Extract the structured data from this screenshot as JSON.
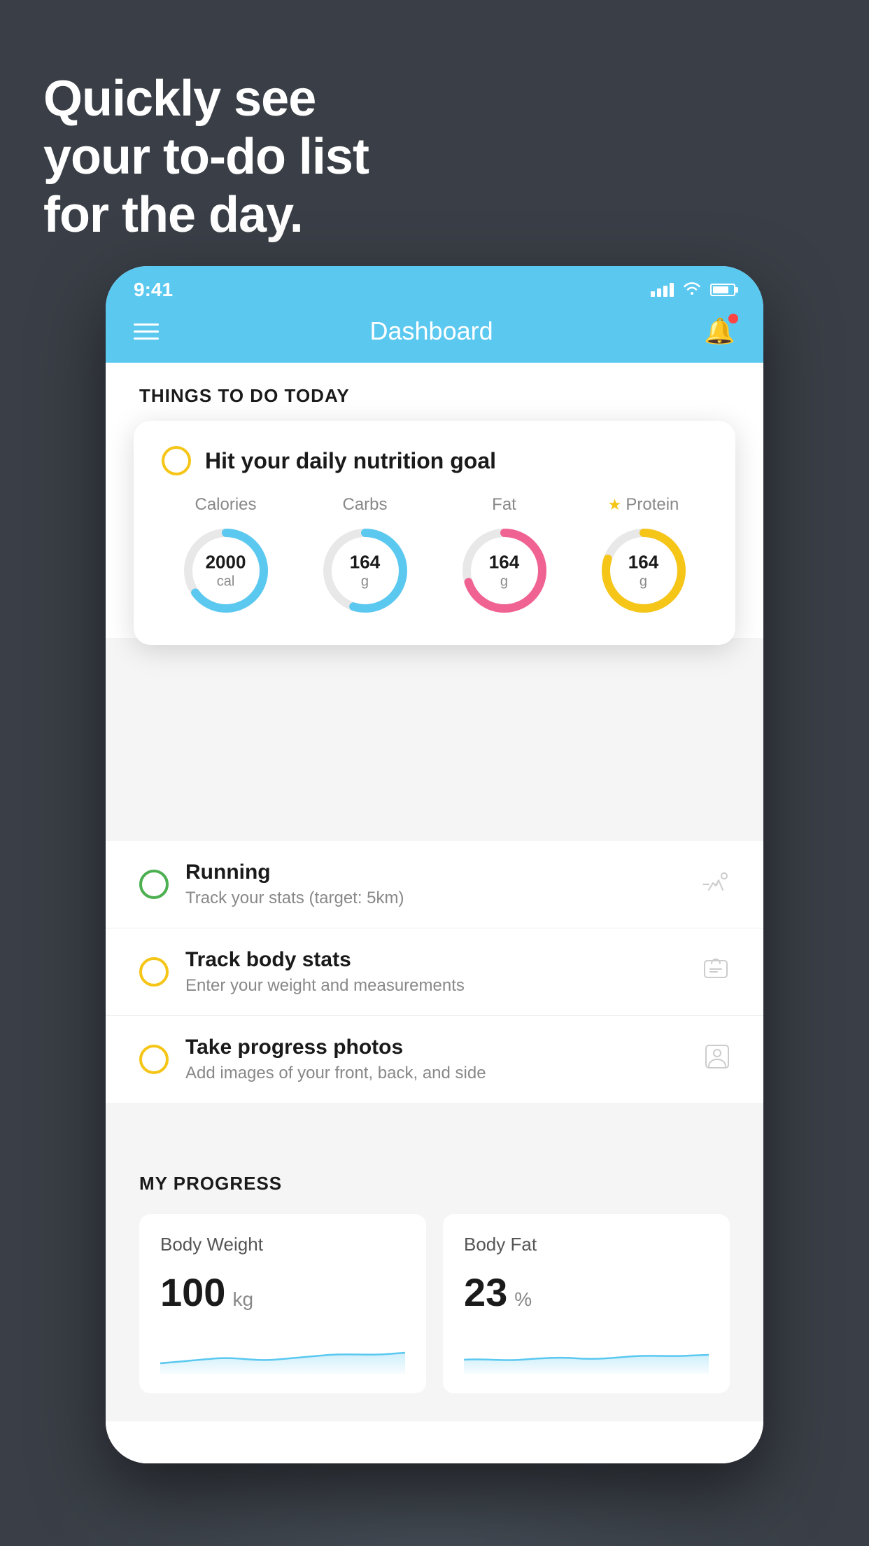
{
  "hero": {
    "line1": "Quickly see",
    "line2": "your to-do list",
    "line3": "for the day."
  },
  "status_bar": {
    "time": "9:41"
  },
  "nav": {
    "title": "Dashboard"
  },
  "things_today": {
    "section_label": "THINGS TO DO TODAY"
  },
  "nutrition_card": {
    "title": "Hit your daily nutrition goal",
    "metrics": [
      {
        "label": "Calories",
        "value": "2000",
        "unit": "cal",
        "color": "#5bc8f0",
        "percent": 65
      },
      {
        "label": "Carbs",
        "value": "164",
        "unit": "g",
        "color": "#5bc8f0",
        "percent": 55
      },
      {
        "label": "Fat",
        "value": "164",
        "unit": "g",
        "color": "#f06292",
        "percent": 70
      },
      {
        "label": "Protein",
        "value": "164",
        "unit": "g",
        "color": "#f5c518",
        "percent": 80,
        "has_star": true
      }
    ]
  },
  "todo_items": [
    {
      "title": "Running",
      "subtitle": "Track your stats (target: 5km)",
      "circle_color": "green",
      "icon": "🏃"
    },
    {
      "title": "Track body stats",
      "subtitle": "Enter your weight and measurements",
      "circle_color": "yellow",
      "icon": "⚖️"
    },
    {
      "title": "Take progress photos",
      "subtitle": "Add images of your front, back, and side",
      "circle_color": "yellow",
      "icon": "👤"
    }
  ],
  "progress": {
    "section_label": "MY PROGRESS",
    "cards": [
      {
        "title": "Body Weight",
        "value": "100",
        "unit": "kg"
      },
      {
        "title": "Body Fat",
        "value": "23",
        "unit": "%"
      }
    ]
  }
}
